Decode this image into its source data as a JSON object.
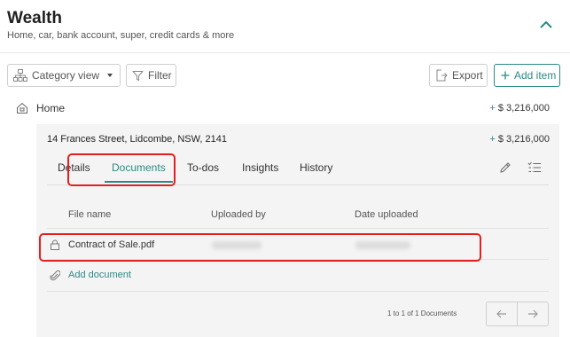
{
  "section": {
    "title": "Wealth",
    "subtitle": "Home, car, bank account, super, credit cards & more"
  },
  "toolbar": {
    "category_view_label": "Category view",
    "filter_label": "Filter",
    "export_label": "Export",
    "add_item_label": "Add item"
  },
  "group": {
    "label": "Home",
    "amount_sign": "+",
    "amount": "$ 3,216,000"
  },
  "asset": {
    "address": "14 Frances Street, Lidcombe, NSW, 2141",
    "amount_sign": "+",
    "amount": "$ 3,216,000",
    "tabs": [
      "Details",
      "Documents",
      "To-dos",
      "Insights",
      "History"
    ],
    "active_tab": "Documents"
  },
  "documents": {
    "columns": [
      "File name",
      "Uploaded by",
      "Date uploaded"
    ],
    "rows": [
      {
        "file_name": "Contract of Sale.pdf"
      }
    ],
    "add_label": "Add document",
    "pagination_text": "1 to 1 of 1 Documents"
  },
  "colors": {
    "accent": "#2b8a84",
    "highlight": "#e02020"
  }
}
